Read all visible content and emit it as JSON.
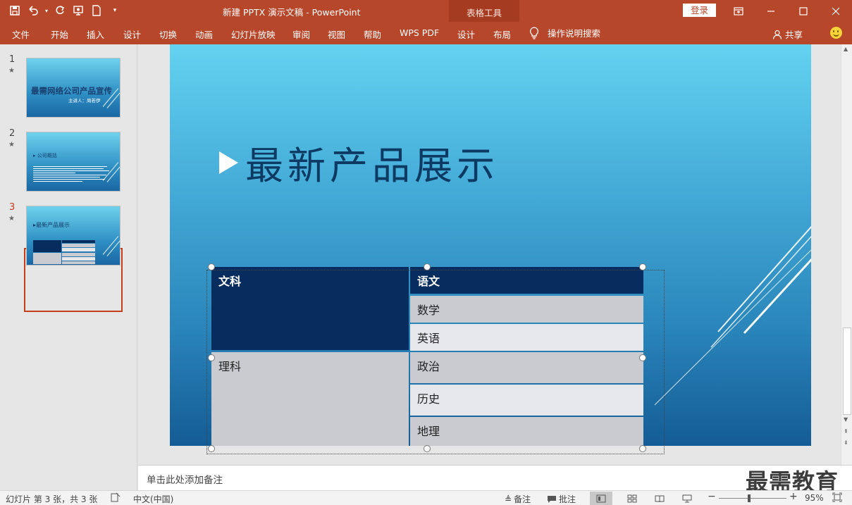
{
  "app": {
    "doc_title": "新建 PPTX 演示文稿  -  PowerPoint",
    "context_tab": "表格工具",
    "login": "登录"
  },
  "ribbon": {
    "tabs": [
      "文件",
      "开始",
      "插入",
      "设计",
      "切换",
      "动画",
      "幻灯片放映",
      "审阅",
      "视图",
      "帮助",
      "WPS PDF",
      "设计",
      "布局"
    ],
    "tell_me": "操作说明搜索",
    "share": "共享"
  },
  "thumbnails": [
    {
      "num": "1",
      "title": "最需网络公司产品宣传",
      "subtitle": "主讲人：周若伊"
    },
    {
      "num": "2",
      "title": "公司概括"
    },
    {
      "num": "3",
      "title": "最新产品展示",
      "active": true
    }
  ],
  "slide": {
    "title": "最新产品展示",
    "table": {
      "header_left": "文科",
      "header_right": "语文",
      "row_math": "数学",
      "row_english": "英语",
      "left_bottom": "理科",
      "row_politics": "政治",
      "row_history": "历史",
      "row_geography": "地理"
    }
  },
  "notes": {
    "placeholder": "单击此处添加备注"
  },
  "watermark": "最需教育",
  "status": {
    "slide_info": "幻灯片 第 3 张，共 3 张",
    "language": "中文(中国)",
    "notes_btn": "备注",
    "comments_btn": "批注",
    "zoom": "95%"
  },
  "colors": {
    "accent": "#b7472a",
    "table_header": "#072d5f",
    "selection": "#c43e1c"
  }
}
